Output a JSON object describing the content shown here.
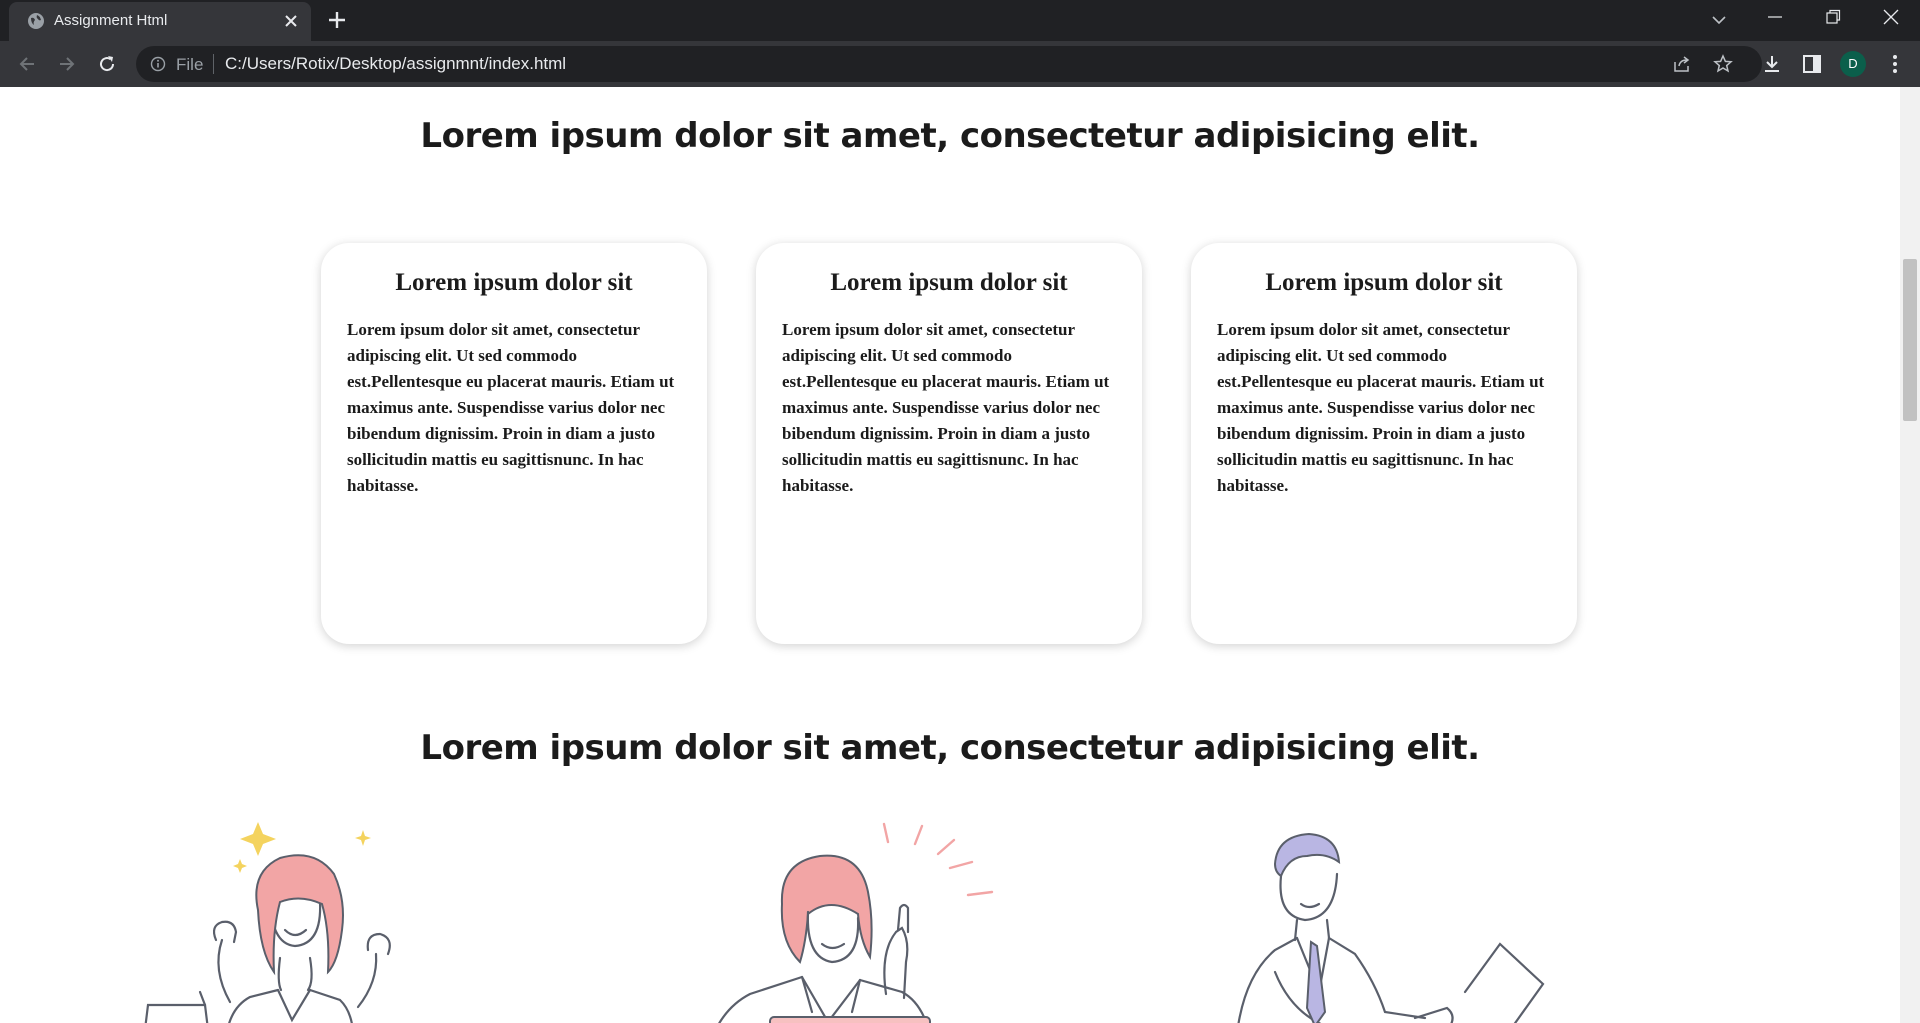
{
  "browser": {
    "tab_title": "Assignment Html",
    "url_scheme": "File",
    "url": "C:/Users/Rotix/Desktop/assignmnt/index.html",
    "profile_initial": "D",
    "accent_color": "#0b5f4b"
  },
  "page": {
    "section1_heading": "Lorem ipsum dolor sit amet, consectetur adipisicing elit.",
    "cards": [
      {
        "title": "Lorem ipsum dolor sit",
        "body": "Lorem ipsum dolor sit amet, consectetur adipiscing elit. Ut sed commodo est.Pellentesque eu placerat mauris. Etiam ut maximus ante. Suspendisse varius dolor nec bibendum dignissim. Proin in diam a justo sollicitudin mattis eu sagittisnunc. In hac habitasse."
      },
      {
        "title": "Lorem ipsum dolor sit",
        "body": "Lorem ipsum dolor sit amet, consectetur adipiscing elit. Ut sed commodo est.Pellentesque eu placerat mauris. Etiam ut maximus ante. Suspendisse varius dolor nec bibendum dignissim. Proin in diam a justo sollicitudin mattis eu sagittisnunc. In hac habitasse."
      },
      {
        "title": "Lorem ipsum dolor sit",
        "body": "Lorem ipsum dolor sit amet, consectetur adipiscing elit. Ut sed commodo est.Pellentesque eu placerat mauris. Etiam ut maximus ante. Suspendisse varius dolor nec bibendum dignissim. Proin in diam a justo sollicitudin mattis eu sagittisnunc. In hac habitasse."
      }
    ],
    "section2_heading": "Lorem ipsum dolor sit amet, consectetur adipisicing elit.",
    "illustrations": [
      "celebrating-woman-illustration",
      "idea-woman-laptop-illustration",
      "businessman-laptop-illustration"
    ]
  }
}
